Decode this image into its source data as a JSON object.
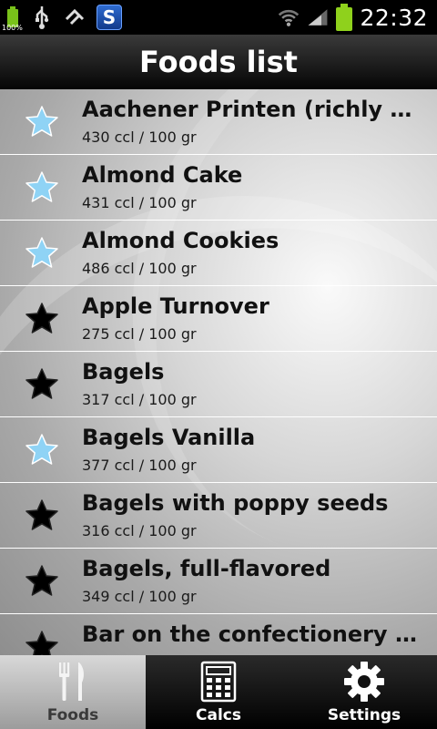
{
  "status_bar": {
    "battery_small_label": "100%",
    "time": "22:32"
  },
  "header": {
    "title": "Foods list"
  },
  "foods": [
    {
      "name": "Aachener Printen (richly spiced gingerbread)",
      "calories": "430 ccl / 100 gr",
      "favorite": true
    },
    {
      "name": "Almond Cake",
      "calories": "431 ccl / 100 gr",
      "favorite": true
    },
    {
      "name": "Almond Cookies",
      "calories": "486 ccl / 100 gr",
      "favorite": true
    },
    {
      "name": "Apple Turnover",
      "calories": "275 ccl / 100 gr",
      "favorite": false
    },
    {
      "name": "Bagels",
      "calories": "317 ccl / 100 gr",
      "favorite": false
    },
    {
      "name": "Bagels Vanilla",
      "calories": "377 ccl / 100 gr",
      "favorite": true
    },
    {
      "name": "Bagels with poppy seeds",
      "calories": "316 ccl / 100 gr",
      "favorite": false
    },
    {
      "name": "Bagels, full-flavored",
      "calories": "349 ccl / 100 gr",
      "favorite": false
    },
    {
      "name": "Bar on the confectionery fat",
      "calories": "",
      "favorite": false
    }
  ],
  "tabs": [
    {
      "label": "Foods",
      "icon": "fork-knife-icon",
      "active": true
    },
    {
      "label": "Calcs",
      "icon": "calculator-icon",
      "active": false
    },
    {
      "label": "Settings",
      "icon": "gear-icon",
      "active": false
    }
  ],
  "colors": {
    "favorite_star": "#8fd3f5",
    "regular_star": "#000000"
  }
}
